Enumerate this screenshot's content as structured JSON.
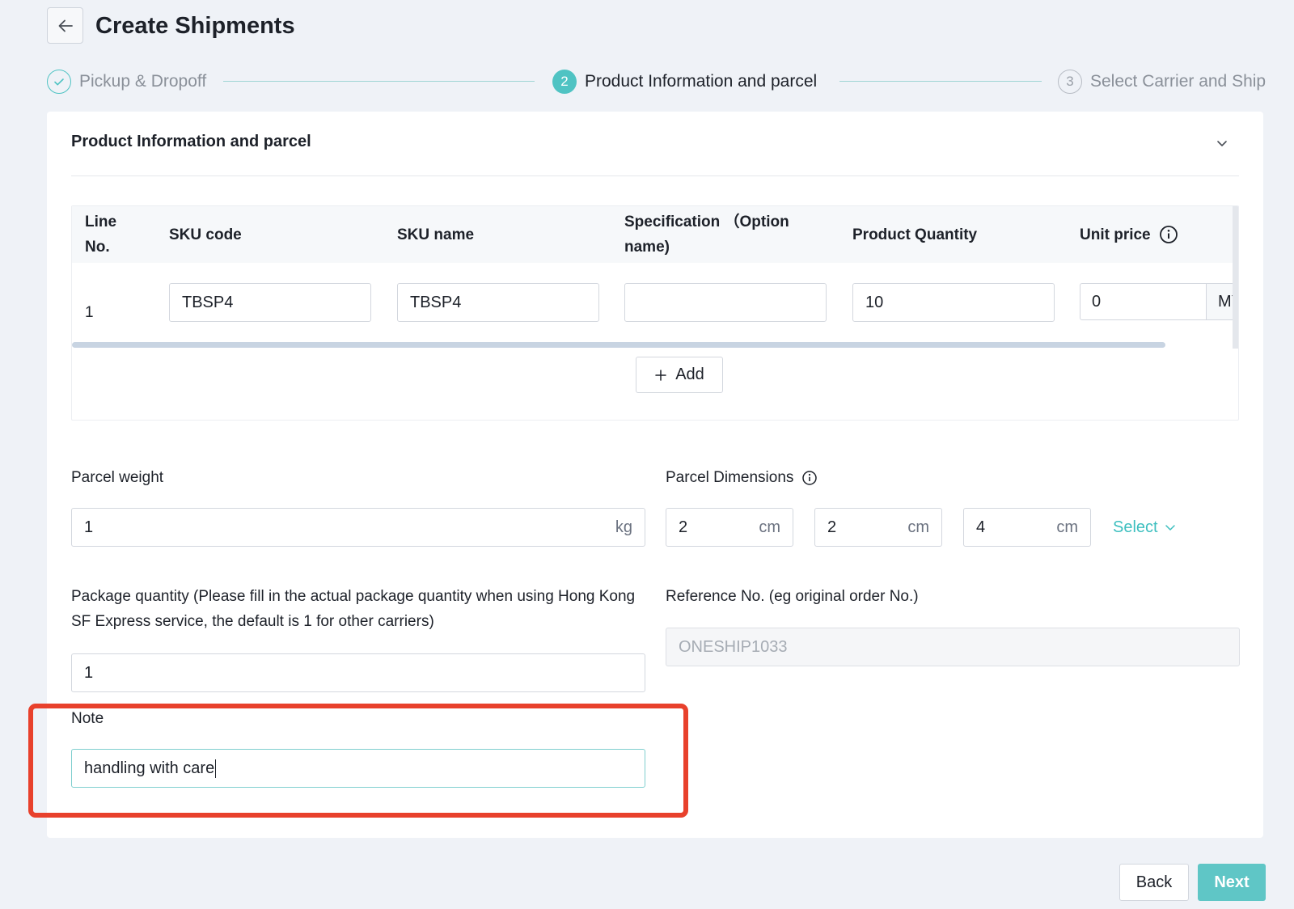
{
  "header": {
    "title": "Create Shipments"
  },
  "steps": [
    {
      "label": "Pickup & Dropoff",
      "number": "",
      "state": "done"
    },
    {
      "label": "Product Information and parcel",
      "number": "2",
      "state": "active"
    },
    {
      "label": "Select Carrier and Ship",
      "number": "3",
      "state": "todo"
    }
  ],
  "section": {
    "title": "Product Information and parcel"
  },
  "table": {
    "headers": {
      "line": "Line No.",
      "sku_code": "SKU code",
      "sku_name": "SKU name",
      "spec": "Specification （Option name)",
      "qty": "Product Quantity",
      "price": "Unit price"
    },
    "rows": [
      {
        "line": "1",
        "sku_code": "TBSP4",
        "sku_name": "TBSP4",
        "spec": "",
        "qty": "10",
        "price": "0",
        "currency": "MY"
      }
    ],
    "add_label": "Add"
  },
  "parcel": {
    "weight_label": "Parcel weight",
    "weight_value": "1",
    "weight_unit": "kg",
    "dims_label": "Parcel Dimensions",
    "dims": [
      {
        "value": "2",
        "unit": "cm"
      },
      {
        "value": "2",
        "unit": "cm"
      },
      {
        "value": "4",
        "unit": "cm"
      }
    ],
    "select_label": "Select"
  },
  "package": {
    "label": "Package quantity (Please fill in the actual package quantity when using Hong Kong SF Express service, the default is 1 for other carriers)",
    "value": "1"
  },
  "reference": {
    "label": "Reference No. (eg original order No.)",
    "placeholder": "ONESHIP1033"
  },
  "note": {
    "label": "Note",
    "value": "handling with care"
  },
  "footer": {
    "back_label": "Back",
    "next_label": "Next"
  },
  "colors": {
    "accent": "#4fc3c3",
    "highlight": "#e8412c"
  }
}
